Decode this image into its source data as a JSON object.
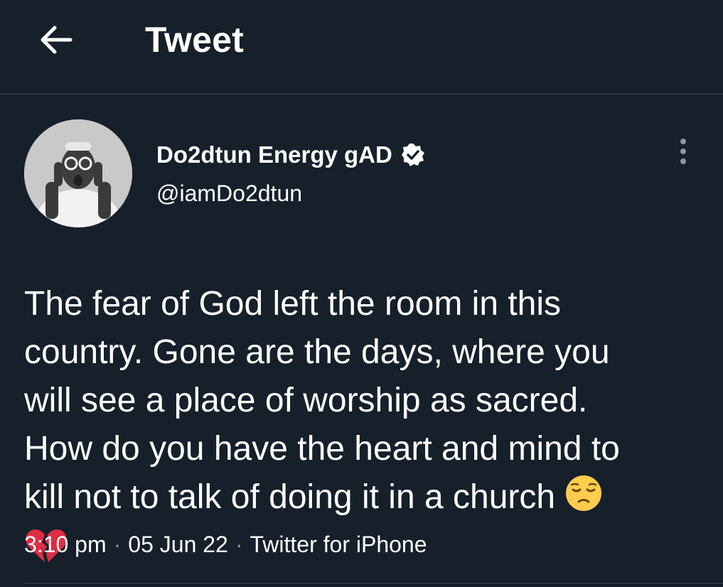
{
  "header": {
    "title": "Tweet",
    "back_icon": "arrow-left-icon"
  },
  "author": {
    "display_name": "Do2dtun Energy gAD",
    "handle": "@iamDo2dtun",
    "verified": true,
    "verified_icon": "verified-badge-icon"
  },
  "tweet": {
    "line1": "The fear of God left the room in this",
    "line2": "country. Gone are the days, where you",
    "line3": "will see a place of worship as sacred.",
    "line4": "How do you have the heart and mind to",
    "line5": "kill not to talk of doing it in a church",
    "emoji1": "pensive-face-emoji",
    "emoji2": "broken-heart-emoji"
  },
  "meta": {
    "time": "3:10 pm",
    "date": "05 Jun 22",
    "source": "Twitter for iPhone",
    "separator": "·"
  },
  "colors": {
    "background": "#15202b",
    "border": "#38444d",
    "text": "#ffffff",
    "secondary": "#8b98a5"
  }
}
